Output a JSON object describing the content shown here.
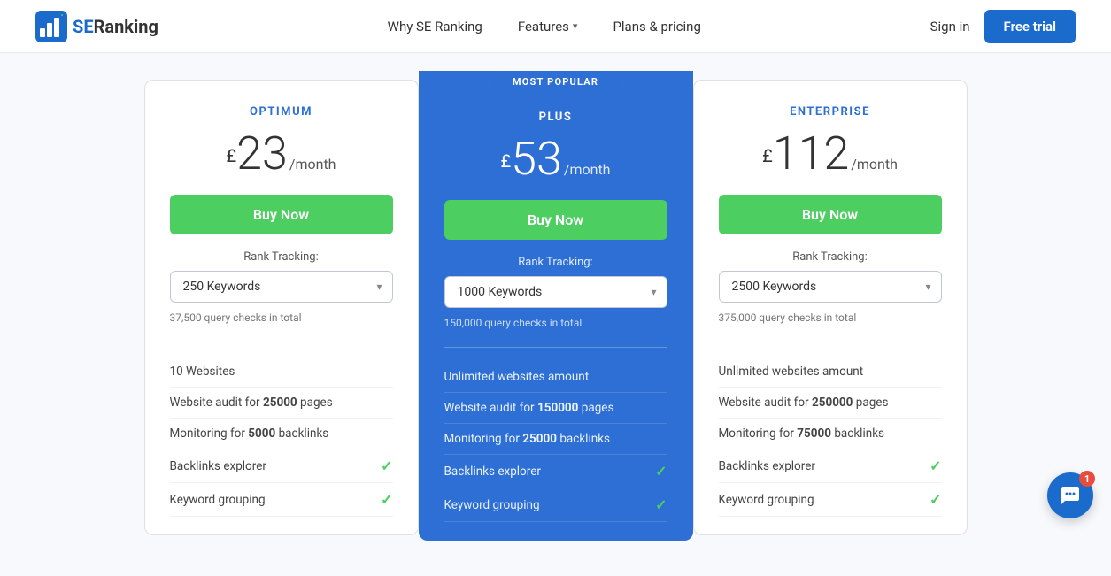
{
  "header": {
    "logo_se": "SE",
    "logo_ranking": "Ranking",
    "nav": [
      {
        "id": "why-se-ranking",
        "label": "Why SE Ranking",
        "hasDropdown": false
      },
      {
        "id": "features",
        "label": "Features",
        "hasDropdown": true
      },
      {
        "id": "plans-pricing",
        "label": "Plans & pricing",
        "hasDropdown": false
      }
    ],
    "sign_in_label": "Sign in",
    "free_trial_label": "Free trial"
  },
  "pricing": {
    "most_popular_label": "MOST POPULAR",
    "plans": [
      {
        "id": "optimum",
        "name": "OPTIMUM",
        "name_class": "optimum",
        "currency": "£",
        "price": "23",
        "period": "/month",
        "buy_label": "Buy Now",
        "rank_tracking_label": "Rank Tracking:",
        "keyword_option": "250 Keywords",
        "query_checks": "37,500 query checks in total",
        "features": [
          {
            "text": "10 Websites",
            "bold_part": "",
            "check": false
          },
          {
            "text_before": "Website audit for ",
            "bold": "25000",
            "text_after": " pages",
            "check": false
          },
          {
            "text_before": "Monitoring for ",
            "bold": "5000",
            "text_after": " backlinks",
            "check": false
          },
          {
            "text": "Backlinks explorer",
            "bold_part": "",
            "check": true
          },
          {
            "text": "Keyword grouping",
            "bold_part": "",
            "check": true
          }
        ]
      },
      {
        "id": "plus",
        "name": "PLUS",
        "name_class": "plus",
        "currency": "£",
        "price": "53",
        "period": "/month",
        "buy_label": "Buy Now",
        "rank_tracking_label": "Rank Tracking:",
        "keyword_option": "1000 Keywords",
        "query_checks": "150,000 query checks in total",
        "features": [
          {
            "text": "Unlimited websites amount",
            "bold_part": "",
            "check": false
          },
          {
            "text_before": "Website audit for ",
            "bold": "150000",
            "text_after": " pages",
            "check": false
          },
          {
            "text_before": "Monitoring for ",
            "bold": "25000",
            "text_after": " backlinks",
            "check": false
          },
          {
            "text": "Backlinks explorer",
            "bold_part": "",
            "check": true
          },
          {
            "text": "Keyword grouping",
            "bold_part": "",
            "check": true
          }
        ]
      },
      {
        "id": "enterprise",
        "name": "ENTERPRISE",
        "name_class": "enterprise",
        "currency": "£",
        "price": "112",
        "period": "/month",
        "buy_label": "Buy Now",
        "rank_tracking_label": "Rank Tracking:",
        "keyword_option": "2500 Keywords",
        "query_checks": "375,000 query checks in total",
        "features": [
          {
            "text": "Unlimited websites amount",
            "bold_part": "",
            "check": false
          },
          {
            "text_before": "Website audit for ",
            "bold": "250000",
            "text_after": " pages",
            "check": false
          },
          {
            "text_before": "Monitoring for ",
            "bold": "75000",
            "text_after": " backlinks",
            "check": false
          },
          {
            "text": "Backlinks explorer",
            "bold_part": "",
            "check": true
          },
          {
            "text": "Keyword grouping",
            "bold_part": "",
            "check": true
          }
        ]
      }
    ]
  },
  "chat": {
    "badge_count": "1"
  }
}
